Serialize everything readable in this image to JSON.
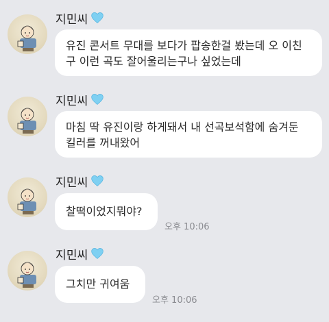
{
  "chat": {
    "messages": [
      {
        "sender": "지민씨",
        "text": "유진 콘서트 무대를 보다가 팝송한걸 봤는데 오 이친\n구 이런 곡도 잘어울리는구나 싶었는데",
        "time": ""
      },
      {
        "sender": "지민씨",
        "text": "마침 딱 유진이랑 하게돼서 내 선곡보석함에 숨겨둔\n킬러를 꺼내왔어",
        "time": ""
      },
      {
        "sender": "지민씨",
        "text": "찰떡이었지뭐야?",
        "time": "오후 10:06"
      },
      {
        "sender": "지민씨",
        "text": "그치만 귀여움",
        "time": "오후 10:06"
      }
    ],
    "colors": {
      "background": "#e7e8ec",
      "bubble": "#ffffff",
      "heart": "#7fd0f2",
      "time": "#8a8b90"
    },
    "icons": {
      "profile": "avatar-cartoon-boy",
      "badge": "light-blue-heart-icon"
    }
  }
}
